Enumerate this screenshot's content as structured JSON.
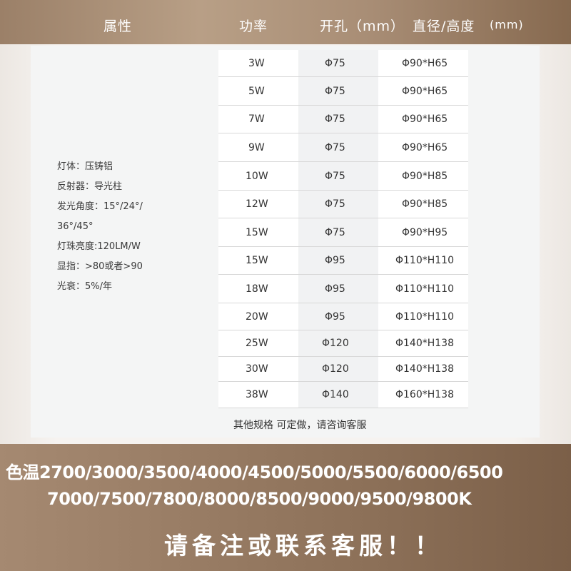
{
  "header": {
    "col_attr": "属性",
    "col_power": "功率",
    "col_cutout": "开孔（mm）",
    "col_dim": "直径/高度",
    "col_dim_unit": "(mm)"
  },
  "attributes": [
    "灯体：压铸铝",
    "反射器：导光柱",
    "发光角度：15°/24°/",
    "36°/45°",
    "灯珠亮度:120LM/W",
    "显指：>80或者>90",
    "光衰：5%/年"
  ],
  "rows": [
    {
      "power": "3W",
      "cutout": "Φ75",
      "dim": "Φ90*H65"
    },
    {
      "power": "5W",
      "cutout": "Φ75",
      "dim": "Φ90*H65"
    },
    {
      "power": "7W",
      "cutout": "Φ75",
      "dim": "Φ90*H65"
    },
    {
      "power": "9W",
      "cutout": "Φ75",
      "dim": "Φ90*H65"
    },
    {
      "power": "10W",
      "cutout": "Φ75",
      "dim": "Φ90*H85"
    },
    {
      "power": "12W",
      "cutout": "Φ75",
      "dim": "Φ90*H85"
    },
    {
      "power": "15W",
      "cutout": "Φ75",
      "dim": "Φ90*H95"
    },
    {
      "power": "15W",
      "cutout": "Φ95",
      "dim": "Φ110*H110"
    },
    {
      "power": "18W",
      "cutout": "Φ95",
      "dim": "Φ110*H110"
    },
    {
      "power": "20W",
      "cutout": "Φ95",
      "dim": "Φ110*H110"
    },
    {
      "power": "25W",
      "cutout": "Φ120",
      "dim": "Φ140*H138"
    },
    {
      "power": "30W",
      "cutout": "Φ120",
      "dim": "Φ140*H138"
    },
    {
      "power": "38W",
      "cutout": "Φ140",
      "dim": "Φ160*H138"
    }
  ],
  "note": "其他规格    可定做，请咨询客服",
  "footer": {
    "color_temp_line1": "色温2700/3000/3500/4000/4500/5000/5500/6000/6500",
    "color_temp_line2": "7000/7500/7800/8000/8500/9000/9500/9800K",
    "cta": "请备注或联系客服！！"
  }
}
